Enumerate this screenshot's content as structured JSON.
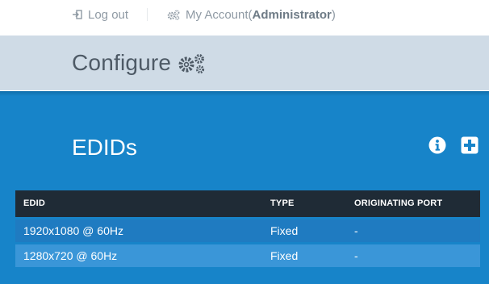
{
  "account_bar": {
    "logout_label": "Log out",
    "myaccount_label": "My Account",
    "role_open": " (",
    "role": "Administrator",
    "role_close": ")"
  },
  "header": {
    "title": "Configure"
  },
  "section": {
    "title": "EDIDs"
  },
  "table": {
    "columns": {
      "edid": "EDID",
      "type": "TYPE",
      "port": "ORIGINATING PORT"
    },
    "rows": [
      {
        "edid": "1920x1080 @ 60Hz",
        "type": "Fixed",
        "port": "-"
      },
      {
        "edid": "1280x720 @ 60Hz",
        "type": "Fixed",
        "port": "-"
      }
    ]
  },
  "icons": {
    "logout": "logout-icon",
    "account": "gears-icon",
    "configure": "gears-icon",
    "info": "info-icon",
    "add": "plus-icon"
  },
  "colors": {
    "header_bg": "#cfdbe6",
    "panel_bg": "#1784c9",
    "table_header_bg": "#1f2b36",
    "row_odd": "#1f7bc1",
    "row_even": "#3a96d8"
  }
}
